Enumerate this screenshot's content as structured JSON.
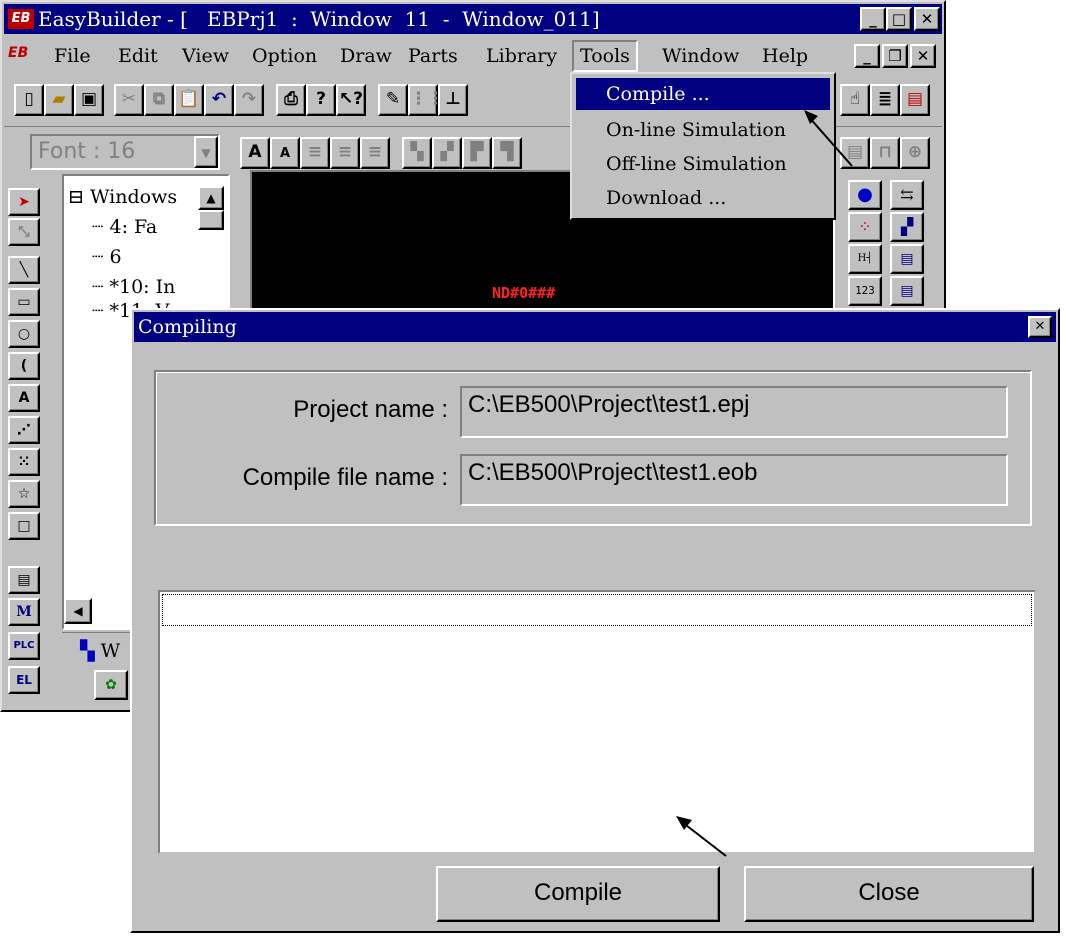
{
  "main_window": {
    "title": "EasyBuilder - [   EBPrj1  :  Window  11  -  Window_011]",
    "app_icon": "EB",
    "title_buttons": [
      "minimize-icon",
      "maximize-icon",
      "close-icon"
    ],
    "menu": [
      {
        "label": "File"
      },
      {
        "label": "Edit"
      },
      {
        "label": "View"
      },
      {
        "label": "Option"
      },
      {
        "label": "Draw"
      },
      {
        "label": "Parts"
      },
      {
        "label": "Library"
      },
      {
        "label": "Tools"
      },
      {
        "label": "Window"
      },
      {
        "label": "Help"
      }
    ],
    "font_box": "Font : 16",
    "tree": {
      "root": "Windows",
      "items": [
        "4: Fa",
        "6",
        "*10: In",
        "*11: V"
      ]
    },
    "canvas_text": "ND#0###",
    "tree_tab_label": "W"
  },
  "tools_menu": {
    "items": [
      {
        "label": "Compile ...",
        "selected": true
      },
      {
        "label": "On-line Simulation",
        "selected": false
      },
      {
        "label": "Off-line Simulation",
        "selected": false
      },
      {
        "label": "Download ...",
        "selected": false
      }
    ]
  },
  "compiling_dialog": {
    "title": "Compiling",
    "project_label": "Project name :",
    "project_value": "C:\\EB500\\Project\\test1.epj",
    "compile_file_label": "Compile file name :",
    "compile_file_value": "C:\\EB500\\Project\\test1.eob",
    "compile_button": "Compile",
    "close_button": "Close"
  },
  "colors": {
    "titlebar": "#000080",
    "face": "#c0c0c0",
    "canvas": "#000000"
  }
}
